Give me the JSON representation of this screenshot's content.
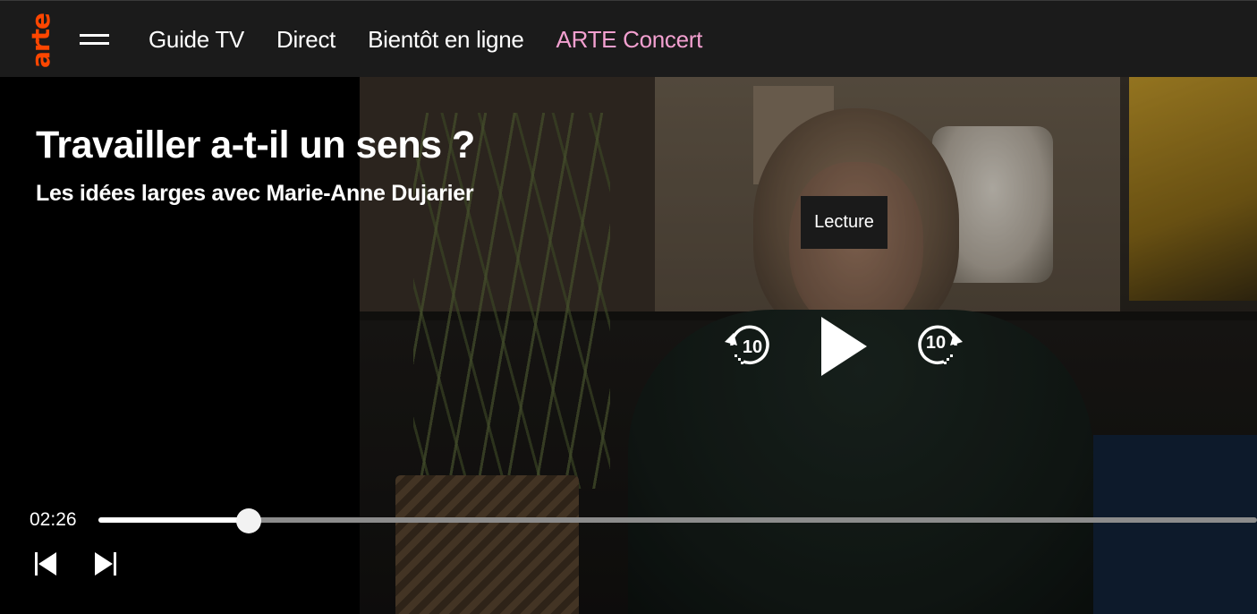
{
  "header": {
    "logo_text": "arte",
    "nav": [
      {
        "label": "Guide TV"
      },
      {
        "label": "Direct"
      },
      {
        "label": "Bientôt en ligne"
      },
      {
        "label": "ARTE Concert",
        "color": "#f3a0d0"
      }
    ]
  },
  "video": {
    "title": "Travailler a-t-il un sens ?",
    "subtitle": "Les idées larges avec Marie-Anne Dujarier",
    "tooltip": "Lecture",
    "rewind_seconds": "10",
    "forward_seconds": "10",
    "current_time": "02:26",
    "progress_fraction": 0.13
  },
  "icons": {
    "menu": "hamburger-icon",
    "rewind": "rewind-10-icon",
    "play": "play-icon",
    "forward": "forward-10-icon",
    "previous": "skip-previous-icon",
    "next": "skip-next-icon"
  },
  "colors": {
    "logo": "#fd4600",
    "accent_link": "#f3a0d0",
    "topbar": "#1b1b1b"
  }
}
